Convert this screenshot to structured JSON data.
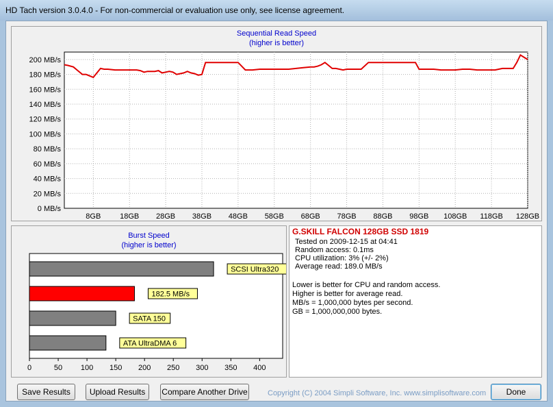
{
  "window": {
    "title": "HD Tach version 3.0.4.0  - For non-commercial or evaluation use only, see license agreement."
  },
  "sequential": {
    "title": "Sequential Read Speed",
    "subtitle": "(higher is better)"
  },
  "burst": {
    "title": "Burst Speed",
    "subtitle": "(higher is better)"
  },
  "info": {
    "drive_name": "G.SKILL FALCON 128GB SSD 1819",
    "tested_on": "Tested on 2009-12-15 at 04:41",
    "random_access": "Random access: 0.1ms",
    "cpu": "CPU utilization: 3% (+/- 2%)",
    "avg_read": "Average read: 189.0 MB/s",
    "note1": "Lower is better for CPU and random access.",
    "note2": "Higher is better for average read.",
    "note3": "MB/s = 1,000,000 bytes per second.",
    "note4": "GB = 1,000,000,000 bytes."
  },
  "buttons": {
    "save": "Save Results",
    "upload": "Upload Results",
    "compare": "Compare Another Drive",
    "done": "Done"
  },
  "copyright": "Copyright (C) 2004 Simpli Software, Inc. www.simplisoftware.com",
  "chart_data": [
    {
      "type": "line",
      "title": "Sequential Read Speed",
      "subtitle": "(higher is better)",
      "y_ticks": [
        "0 MB/s",
        "20 MB/s",
        "40 MB/s",
        "60 MB/s",
        "80 MB/s",
        "100 MB/s",
        "120 MB/s",
        "140 MB/s",
        "160 MB/s",
        "180 MB/s",
        "200 MB/s"
      ],
      "x_ticks": [
        "8GB",
        "18GB",
        "28GB",
        "38GB",
        "48GB",
        "58GB",
        "68GB",
        "78GB",
        "88GB",
        "98GB",
        "108GB",
        "118GB",
        "128GB"
      ],
      "x_tick_values": [
        8,
        18,
        28,
        38,
        48,
        58,
        68,
        78,
        88,
        98,
        108,
        118,
        128
      ],
      "xlim": [
        0,
        128
      ],
      "ylim": [
        0,
        210
      ],
      "grid": true,
      "line_color": "#e00000",
      "series": [
        {
          "x": [
            0,
            1,
            2.5,
            3.5,
            5,
            6,
            8,
            9,
            10,
            11,
            12,
            14,
            16,
            18,
            20,
            21,
            22,
            23,
            25,
            26,
            27,
            28,
            29,
            30,
            31,
            32,
            33,
            34,
            35,
            36,
            37,
            38,
            39,
            40,
            42,
            44,
            46,
            48,
            50,
            52,
            54,
            56,
            58,
            60,
            62,
            64,
            66,
            68,
            69,
            70,
            71,
            72,
            73,
            74,
            75,
            76,
            77,
            78,
            79,
            80,
            82,
            84,
            86,
            88,
            90,
            92,
            94,
            96,
            97,
            98,
            100,
            102,
            104,
            106,
            108,
            110,
            112,
            114,
            116,
            118,
            119,
            120,
            121,
            122,
            123,
            124,
            125,
            126,
            127,
            128
          ],
          "y": [
            193,
            192,
            190,
            186,
            180,
            180,
            176,
            182,
            188,
            187,
            187,
            186,
            186,
            186,
            186,
            185,
            183,
            184,
            184,
            185,
            182,
            183,
            184,
            183,
            180,
            181,
            182,
            184,
            182,
            181,
            179,
            180,
            196,
            196,
            196,
            196,
            196,
            196,
            186,
            186,
            187,
            187,
            187,
            187,
            187,
            188,
            189,
            190,
            190,
            191,
            193,
            196,
            192,
            188,
            188,
            187,
            186,
            187,
            187,
            187,
            187,
            196,
            196,
            196,
            196,
            196,
            196,
            196,
            196,
            187,
            187,
            187,
            186,
            186,
            186,
            187,
            187,
            186,
            186,
            186,
            186,
            187,
            188,
            188,
            188,
            188,
            196,
            206,
            203,
            200
          ]
        }
      ]
    },
    {
      "type": "bar",
      "orientation": "horizontal",
      "title": "Burst Speed",
      "subtitle": "(higher is better)",
      "categories": [
        "SCSI Ultra320",
        "182.5 MB/s",
        "SATA 150",
        "ATA UltraDMA 6"
      ],
      "values": [
        320,
        182.5,
        150,
        133
      ],
      "colors": [
        "#808080",
        "#ff0000",
        "#808080",
        "#808080"
      ],
      "x_ticks": [
        "0",
        "50",
        "100",
        "150",
        "200",
        "250",
        "300",
        "350",
        "400"
      ],
      "x_tick_values": [
        0,
        50,
        100,
        150,
        200,
        250,
        300,
        350,
        400
      ],
      "xlim": [
        0,
        440
      ],
      "grid": false
    }
  ]
}
